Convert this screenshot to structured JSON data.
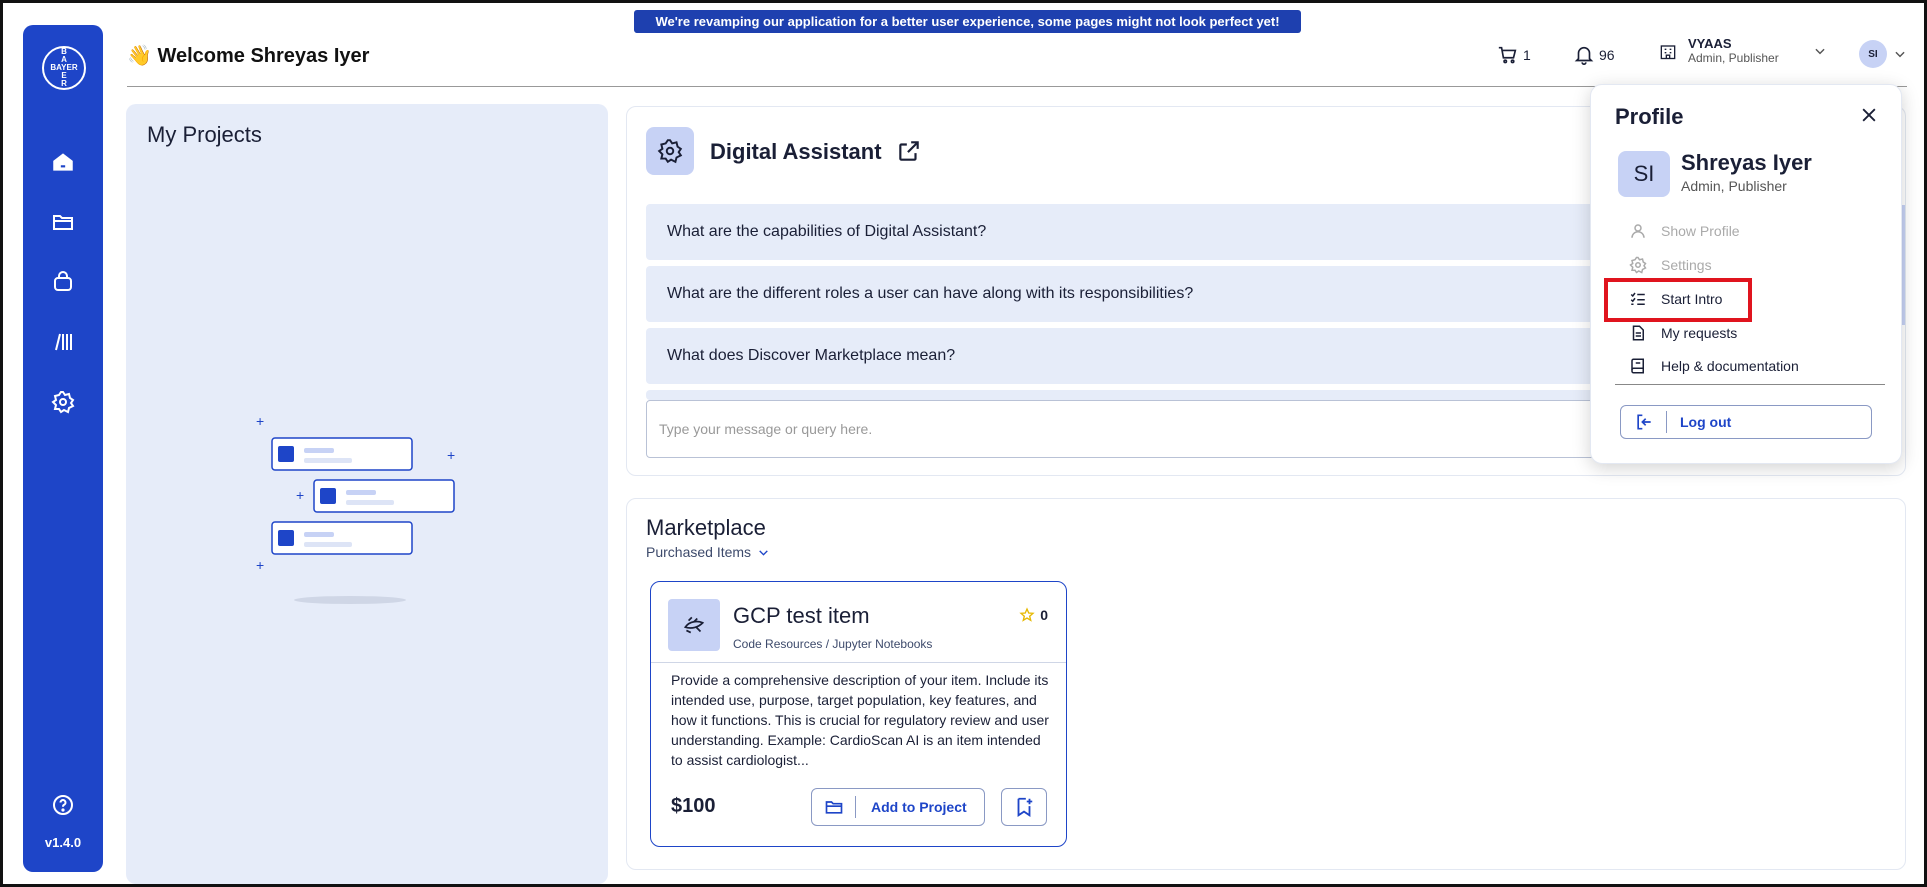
{
  "banner": "We're revamping our application for a better user experience, some pages might not look perfect yet!",
  "sidebar": {
    "logo_text": "BAYER",
    "items": [
      {
        "icon": "home-icon"
      },
      {
        "icon": "folder-icon"
      },
      {
        "icon": "bag-icon"
      },
      {
        "icon": "library-icon"
      },
      {
        "icon": "gear-icon"
      }
    ],
    "help_icon": "help-icon",
    "version": "v1.4.0"
  },
  "header": {
    "welcome": "👋 Welcome Shreyas Iyer",
    "cart_count": "1",
    "notif_count": "96",
    "org_name": "VYAAS",
    "org_role": "Admin, Publisher",
    "avatar_initials": "SI"
  },
  "projects": {
    "title": "My Projects"
  },
  "assistant": {
    "title": "Digital Assistant",
    "questions": [
      "What are the capabilities of Digital Assistant?",
      "What are the different roles a user can have along with its responsibilities?",
      "What does Discover Marketplace mean?"
    ],
    "input_placeholder": "Type your message or query here."
  },
  "marketplace": {
    "title": "Marketplace",
    "filter": "Purchased Items",
    "card": {
      "title": "GCP test item",
      "category": "Code Resources / Jupyter Notebooks",
      "rating": "0",
      "description": "Provide a comprehensive description of your item. Include its intended use, purpose, target population, key features, and how it functions. This is crucial for regulatory review and user understanding. Example: CardioScan AI is an item intended to assist cardiologist...",
      "price": "$100",
      "add_label": "Add to Project"
    }
  },
  "profile": {
    "title": "Profile",
    "initials": "SI",
    "name": "Shreyas Iyer",
    "role": "Admin, Publisher",
    "menu": [
      {
        "label": "Show Profile",
        "icon": "user-icon"
      },
      {
        "label": "Settings",
        "icon": "gear-icon"
      },
      {
        "label": "Start Intro",
        "icon": "checklist-icon"
      },
      {
        "label": "My requests",
        "icon": "document-icon"
      },
      {
        "label": "Help & documentation",
        "icon": "book-icon"
      }
    ],
    "logout": "Log out"
  },
  "colors": {
    "primary": "#1e45c8",
    "panel": "#e6ecf9",
    "highlight": "#e0141e"
  }
}
